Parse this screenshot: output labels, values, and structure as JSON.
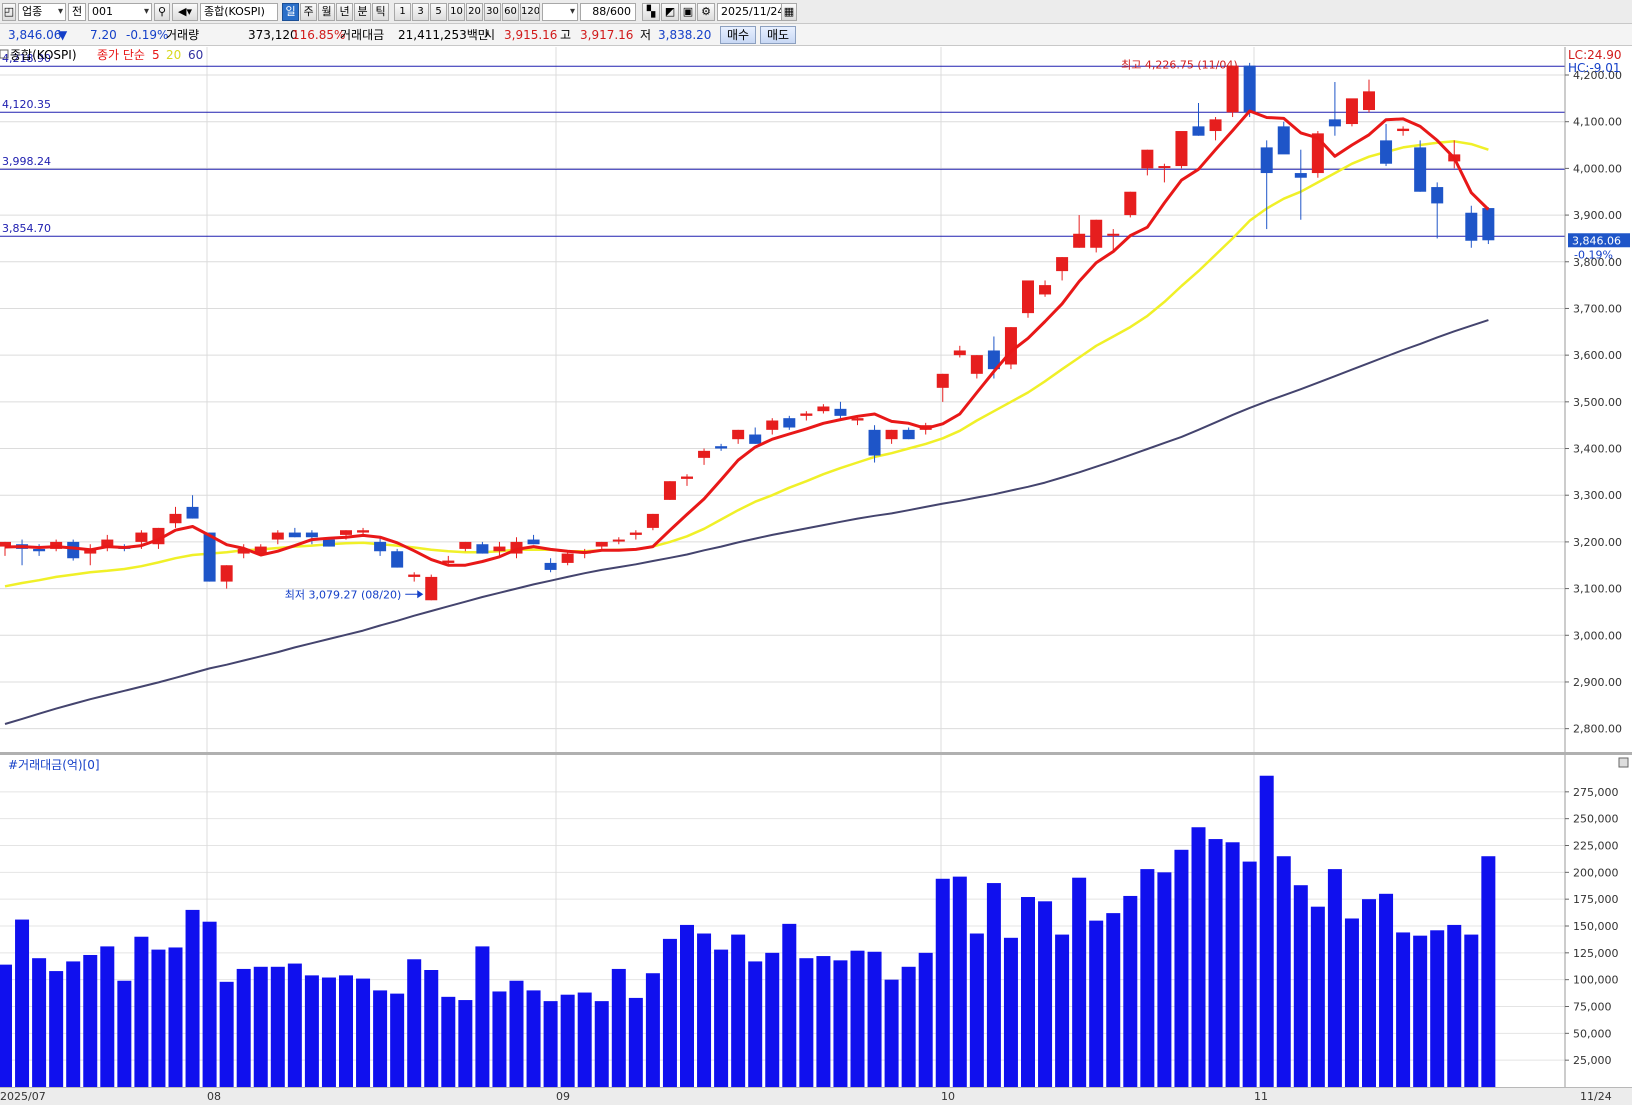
{
  "toolbar": {
    "market_type": "업종",
    "period_mode": "전",
    "code": "001",
    "index_name": "종합(KOSPI)",
    "periods": [
      "일",
      "주",
      "월",
      "년",
      "분",
      "틱"
    ],
    "active_period": "일",
    "intervals": [
      "1",
      "3",
      "5",
      "10",
      "20",
      "30",
      "60",
      "120"
    ],
    "count": "88",
    "total": "/600",
    "date": "2025/11/24"
  },
  "quote": {
    "price": "3,846.06",
    "direction": "▼",
    "change": "7.20",
    "change_pct": "-0.19%",
    "volume_label": "거래량",
    "volume": "373,120",
    "volume_ratio": "116.85%",
    "amount_label": "거래대금",
    "amount": "21,411,253백만",
    "open_label": "시",
    "open": "3,915.16",
    "high_label": "고",
    "high": "3,917.16",
    "low_label": "저",
    "low": "3,838.20",
    "buy_label": "매수",
    "sell_label": "매도"
  },
  "legend": {
    "index": "종합(KOSPI)",
    "ma_label": "종가 단순",
    "ma5": "5",
    "ma20": "20",
    "ma60": "60"
  },
  "corner_labels": {
    "lc": "LC:24.90",
    "hc": "HC:-9.01"
  },
  "volume_legend": "#거래대금(억)[0]",
  "date_labels": [
    "2025/07",
    "08",
    "09",
    "10",
    "11",
    "11/24"
  ],
  "colors": {
    "up": "#e61e1e",
    "down": "#1e55c8",
    "ma5": "#e81818",
    "ma20": "#f0f028",
    "ma60": "#44446e",
    "volume": "#1010ee",
    "hline": "#2020b0"
  },
  "chart_data": [
    {
      "type": "candlestick",
      "title": "종합(KOSPI)",
      "ylim": [
        2750,
        4260
      ],
      "y_ticks": [
        2800,
        2900,
        3000,
        3100,
        3200,
        3300,
        3400,
        3500,
        3600,
        3700,
        3800,
        3900,
        4000,
        4100,
        4200
      ],
      "y_tick_labels": [
        "2,800.00",
        "2,900.00",
        "3,000.00",
        "3,100.00",
        "3,200.00",
        "3,300.00",
        "3,400.00",
        "3,500.00",
        "3,600.00",
        "3,700.00",
        "3,800.00",
        "3,900.00",
        "4,000.00",
        "4,100.00",
        "4,200.00"
      ],
      "reference_lines": [
        {
          "value": 4218.9,
          "label": "4,218.90"
        },
        {
          "value": 4120.35,
          "label": "4,120.35"
        },
        {
          "value": 3998.24,
          "label": "3,998.24"
        },
        {
          "value": 3854.7,
          "label": "3,854.70"
        }
      ],
      "annotations": {
        "high": "최고 4,226.75 (11/04)",
        "low": "최저 3,079.27 (08/20)",
        "last_price": "3,846.06",
        "last_change": "-0.19%"
      },
      "candles": [
        [
          3190,
          3200,
          3170,
          3200
        ],
        [
          3195,
          3205,
          3150,
          3185
        ],
        [
          3185,
          3195,
          3170,
          3180
        ],
        [
          3185,
          3205,
          3180,
          3200
        ],
        [
          3200,
          3205,
          3160,
          3165
        ],
        [
          3175,
          3195,
          3150,
          3185
        ],
        [
          3190,
          3215,
          3180,
          3205
        ],
        [
          3190,
          3195,
          3180,
          3185
        ],
        [
          3200,
          3225,
          3185,
          3220
        ],
        [
          3195,
          3230,
          3185,
          3230
        ],
        [
          3240,
          3275,
          3230,
          3260
        ],
        [
          3275,
          3300,
          3250,
          3250
        ],
        [
          3220,
          3220,
          3115,
          3115
        ],
        [
          3115,
          3150,
          3100,
          3150
        ],
        [
          3175,
          3195,
          3165,
          3185
        ],
        [
          3175,
          3195,
          3170,
          3190
        ],
        [
          3205,
          3225,
          3195,
          3220
        ],
        [
          3220,
          3230,
          3210,
          3210
        ],
        [
          3220,
          3225,
          3195,
          3210
        ],
        [
          3205,
          3210,
          3190,
          3190
        ],
        [
          3215,
          3225,
          3205,
          3225
        ],
        [
          3220,
          3230,
          3215,
          3225
        ],
        [
          3200,
          3210,
          3170,
          3180
        ],
        [
          3180,
          3185,
          3145,
          3145
        ],
        [
          3125,
          3135,
          3115,
          3130
        ],
        [
          3075,
          3130,
          3075,
          3125
        ],
        [
          3155,
          3170,
          3150,
          3160
        ],
        [
          3185,
          3200,
          3180,
          3200
        ],
        [
          3195,
          3200,
          3175,
          3175
        ],
        [
          3180,
          3200,
          3170,
          3190
        ],
        [
          3175,
          3210,
          3165,
          3200
        ],
        [
          3205,
          3215,
          3195,
          3195
        ],
        [
          3155,
          3165,
          3135,
          3140
        ],
        [
          3155,
          3180,
          3150,
          3175
        ],
        [
          3175,
          3185,
          3165,
          3180
        ],
        [
          3190,
          3200,
          3180,
          3200
        ],
        [
          3205,
          3210,
          3195,
          3205
        ],
        [
          3215,
          3225,
          3205,
          3220
        ],
        [
          3230,
          3260,
          3225,
          3260
        ],
        [
          3290,
          3330,
          3290,
          3330
        ],
        [
          3335,
          3345,
          3320,
          3340
        ],
        [
          3380,
          3400,
          3365,
          3395
        ],
        [
          3405,
          3410,
          3395,
          3400
        ],
        [
          3420,
          3440,
          3410,
          3440
        ],
        [
          3430,
          3445,
          3410,
          3410
        ],
        [
          3440,
          3465,
          3430,
          3460
        ],
        [
          3465,
          3470,
          3440,
          3445
        ],
        [
          3470,
          3480,
          3460,
          3475
        ],
        [
          3480,
          3495,
          3475,
          3490
        ],
        [
          3485,
          3500,
          3460,
          3470
        ],
        [
          3460,
          3470,
          3450,
          3465
        ],
        [
          3440,
          3450,
          3370,
          3385
        ],
        [
          3420,
          3440,
          3410,
          3440
        ],
        [
          3440,
          3445,
          3420,
          3420
        ],
        [
          3440,
          3455,
          3430,
          3450
        ],
        [
          3530,
          3560,
          3500,
          3560
        ],
        [
          3600,
          3620,
          3595,
          3610
        ],
        [
          3560,
          3600,
          3550,
          3600
        ],
        [
          3610,
          3640,
          3550,
          3570
        ],
        [
          3580,
          3660,
          3570,
          3660
        ],
        [
          3690,
          3760,
          3680,
          3760
        ],
        [
          3730,
          3760,
          3725,
          3750
        ],
        [
          3780,
          3810,
          3760,
          3810
        ],
        [
          3830,
          3900,
          3830,
          3860
        ],
        [
          3830,
          3890,
          3820,
          3890
        ],
        [
          3860,
          3870,
          3820,
          3860
        ],
        [
          3900,
          3950,
          3895,
          3950
        ],
        [
          4000,
          4040,
          3985,
          4040
        ],
        [
          4005,
          4010,
          3970,
          4005
        ],
        [
          4005,
          4070,
          4000,
          4080
        ],
        [
          4090,
          4140,
          4070,
          4070
        ],
        [
          4080,
          4110,
          4060,
          4105
        ],
        [
          4120,
          4220,
          4110,
          4220
        ],
        [
          4220,
          4226,
          4110,
          4120
        ],
        [
          4045,
          4060,
          3870,
          3990
        ],
        [
          4090,
          4100,
          4050,
          4030
        ],
        [
          3990,
          4040,
          3890,
          3980
        ],
        [
          3990,
          4080,
          3980,
          4075
        ],
        [
          4105,
          4185,
          4070,
          4090
        ],
        [
          4095,
          4130,
          4090,
          4150
        ],
        [
          4125,
          4190,
          4120,
          4165
        ],
        [
          4060,
          4095,
          4005,
          4010
        ],
        [
          4080,
          4090,
          4070,
          4085
        ],
        [
          4045,
          4060,
          3950,
          3950
        ],
        [
          3960,
          3970,
          3850,
          3925
        ],
        [
          4015,
          4060,
          4000,
          4030
        ],
        [
          3905,
          3920,
          3830,
          3845
        ],
        [
          3915,
          3917,
          3838,
          3846
        ]
      ],
      "ma5": [
        3189,
        3190,
        3188,
        3190,
        3187,
        3183,
        3190,
        3188,
        3192,
        3205,
        3225,
        3233,
        3214,
        3194,
        3186,
        3172,
        3180,
        3192,
        3205,
        3208,
        3210,
        3214,
        3210,
        3198,
        3181,
        3162,
        3150,
        3150,
        3158,
        3168,
        3184,
        3190,
        3184,
        3180,
        3177,
        3182,
        3182,
        3184,
        3190,
        3225,
        3259,
        3292,
        3333,
        3375,
        3403,
        3420,
        3431,
        3442,
        3454,
        3462,
        3469,
        3474,
        3458,
        3454,
        3443,
        3453,
        3474,
        3520,
        3565,
        3608,
        3636,
        3672,
        3710,
        3758,
        3798,
        3822,
        3856,
        3874,
        3926,
        3975,
        3998,
        4040,
        4081,
        4123,
        4109,
        4107,
        4076,
        4065,
        4026,
        4050,
        4072,
        4104,
        4106,
        4090,
        4060,
        4022,
        3948,
        3912
      ],
      "ma20": [
        3105,
        3112,
        3118,
        3125,
        3130,
        3135,
        3138,
        3142,
        3148,
        3156,
        3165,
        3172,
        3175,
        3178,
        3182,
        3184,
        3187,
        3190,
        3192,
        3195,
        3197,
        3198,
        3195,
        3192,
        3188,
        3183,
        3180,
        3178,
        3178,
        3180,
        3183,
        3183,
        3183,
        3180,
        3180,
        3182,
        3183,
        3184,
        3190,
        3200,
        3212,
        3228,
        3248,
        3268,
        3286,
        3300,
        3316,
        3330,
        3345,
        3358,
        3370,
        3382,
        3390,
        3400,
        3410,
        3422,
        3438,
        3460,
        3480,
        3500,
        3520,
        3544,
        3570,
        3595,
        3620,
        3640,
        3660,
        3684,
        3714,
        3748,
        3780,
        3815,
        3850,
        3888,
        3914,
        3935,
        3950,
        3970,
        3990,
        4010,
        4025,
        4035,
        4045,
        4050,
        4055,
        4058,
        4052,
        4040
      ],
      "ma60": [
        2810,
        2821,
        2832,
        2843,
        2853,
        2863,
        2872,
        2881,
        2890,
        2899,
        2909,
        2919,
        2929,
        2937,
        2946,
        2955,
        2964,
        2974,
        2983,
        2992,
        3001,
        3010,
        3021,
        3031,
        3042,
        3052,
        3062,
        3072,
        3082,
        3091,
        3100,
        3109,
        3117,
        3125,
        3133,
        3140,
        3146,
        3152,
        3159,
        3166,
        3173,
        3182,
        3190,
        3199,
        3207,
        3215,
        3222,
        3229,
        3236,
        3243,
        3250,
        3256,
        3261,
        3268,
        3275,
        3282,
        3288,
        3295,
        3302,
        3310,
        3318,
        3327,
        3338,
        3349,
        3361,
        3373,
        3386,
        3399,
        3412,
        3425,
        3440,
        3456,
        3472,
        3487,
        3501,
        3514,
        3527,
        3541,
        3555,
        3569,
        3583,
        3597,
        3611,
        3624,
        3638,
        3651,
        3663,
        3675
      ]
    },
    {
      "type": "bar",
      "title": "#거래대금(억)[0]",
      "ylim": [
        0,
        300000
      ],
      "y_ticks": [
        25000,
        50000,
        75000,
        100000,
        125000,
        150000,
        175000,
        200000,
        225000,
        250000,
        275000
      ],
      "y_tick_labels": [
        "25,000",
        "50,000",
        "75,000",
        "100,000",
        "125,000",
        "150,000",
        "175,000",
        "200,000",
        "225,000",
        "250,000",
        "275,000"
      ],
      "values": [
        114000,
        156000,
        120000,
        108000,
        117000,
        123000,
        131000,
        99000,
        140000,
        128000,
        130000,
        165000,
        154000,
        98000,
        110000,
        112000,
        112000,
        115000,
        104000,
        102000,
        104000,
        101000,
        90000,
        87000,
        119000,
        109000,
        84000,
        81000,
        131000,
        89000,
        99000,
        90000,
        80000,
        86000,
        88000,
        80000,
        110000,
        83000,
        106000,
        138000,
        151000,
        143000,
        128000,
        142000,
        117000,
        125000,
        152000,
        120000,
        122000,
        118000,
        127000,
        126000,
        100000,
        112000,
        125000,
        194000,
        196000,
        143000,
        190000,
        139000,
        177000,
        173000,
        142000,
        195000,
        155000,
        162000,
        178000,
        203000,
        200000,
        221000,
        242000,
        231000,
        228000,
        210000,
        290000,
        215000,
        188000,
        168000,
        203000,
        157000,
        175000,
        180000,
        144000,
        141000,
        146000,
        151000,
        142000,
        215000
      ]
    }
  ]
}
